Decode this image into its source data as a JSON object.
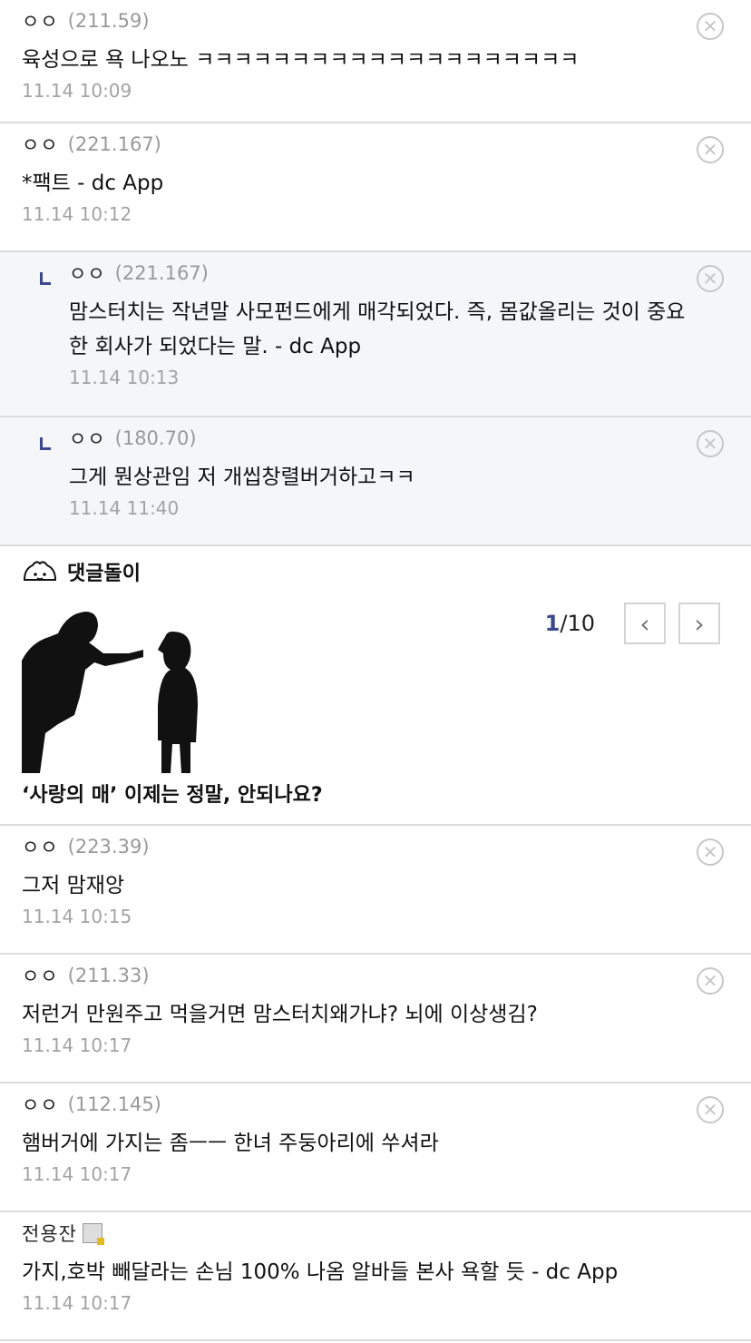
{
  "comments_top": [
    {
      "nick": "ㅇㅇ",
      "ip": "(211.59)",
      "text": "육성으로 욕 나오노 ㅋㅋㅋㅋㅋㅋㅋㅋㅋㅋㅋㅋㅋㅋㅋㅋㅋㅋㅋㅋ",
      "date": "11.14 10:09"
    },
    {
      "nick": "ㅇㅇ",
      "ip": "(221.167)",
      "text": "*팩트 - dc App",
      "date": "11.14 10:12"
    }
  ],
  "replies": [
    {
      "nick": "ㅇㅇ",
      "ip": "(221.167)",
      "text_line1": "맘스터치는 작년말 사모펀드에게 매각되었다. 즉, 몸값올리는 것이 중요",
      "text_line2": "한 회사가 되었다는 말. - dc App",
      "date": "11.14 10:13"
    },
    {
      "nick": "ㅇㅇ",
      "ip": "(180.70)",
      "text": "그게 뭔상관임 저 개씹창렬버거하고ㅋㅋ",
      "date": "11.14 11:40"
    }
  ],
  "bot": {
    "title": "댓글돌이",
    "page_current": "1",
    "page_total": "/10",
    "prev_icon": "chevron-left-icon",
    "next_icon": "chevron-right-icon",
    "caption": "‘사랑의 매’ 이제는 정말, 안되나요?"
  },
  "comments_bottom": [
    {
      "nick": "ㅇㅇ",
      "ip": "(223.39)",
      "text": "그저 맘재앙",
      "date": "11.14 10:15"
    },
    {
      "nick": "ㅇㅇ",
      "ip": "(211.33)",
      "text": "저런거 만원주고 먹을거면 맘스터치왜가냐? 뇌에 이상생김?",
      "date": "11.14 10:17"
    },
    {
      "nick": "ㅇㅇ",
      "ip": "(112.145)",
      "text": "햄버거에 가지는 좀ㅡㅡ 한녀 주둥아리에 쑤셔라",
      "date": "11.14 10:17"
    },
    {
      "nick": "전용잔",
      "ip": "",
      "text": "가지,호박 빼달라는 손님 100% 나옴 알바들 본사 욕할 듯 - dc App",
      "date": "11.14 10:17"
    }
  ],
  "delete_icon": "x-circle-icon",
  "colors": {
    "accent": "#3b4890",
    "ip": "#999999",
    "date": "#a3a3a3",
    "reply_bg": "#f5f6f8",
    "border": "#dcdce0"
  }
}
